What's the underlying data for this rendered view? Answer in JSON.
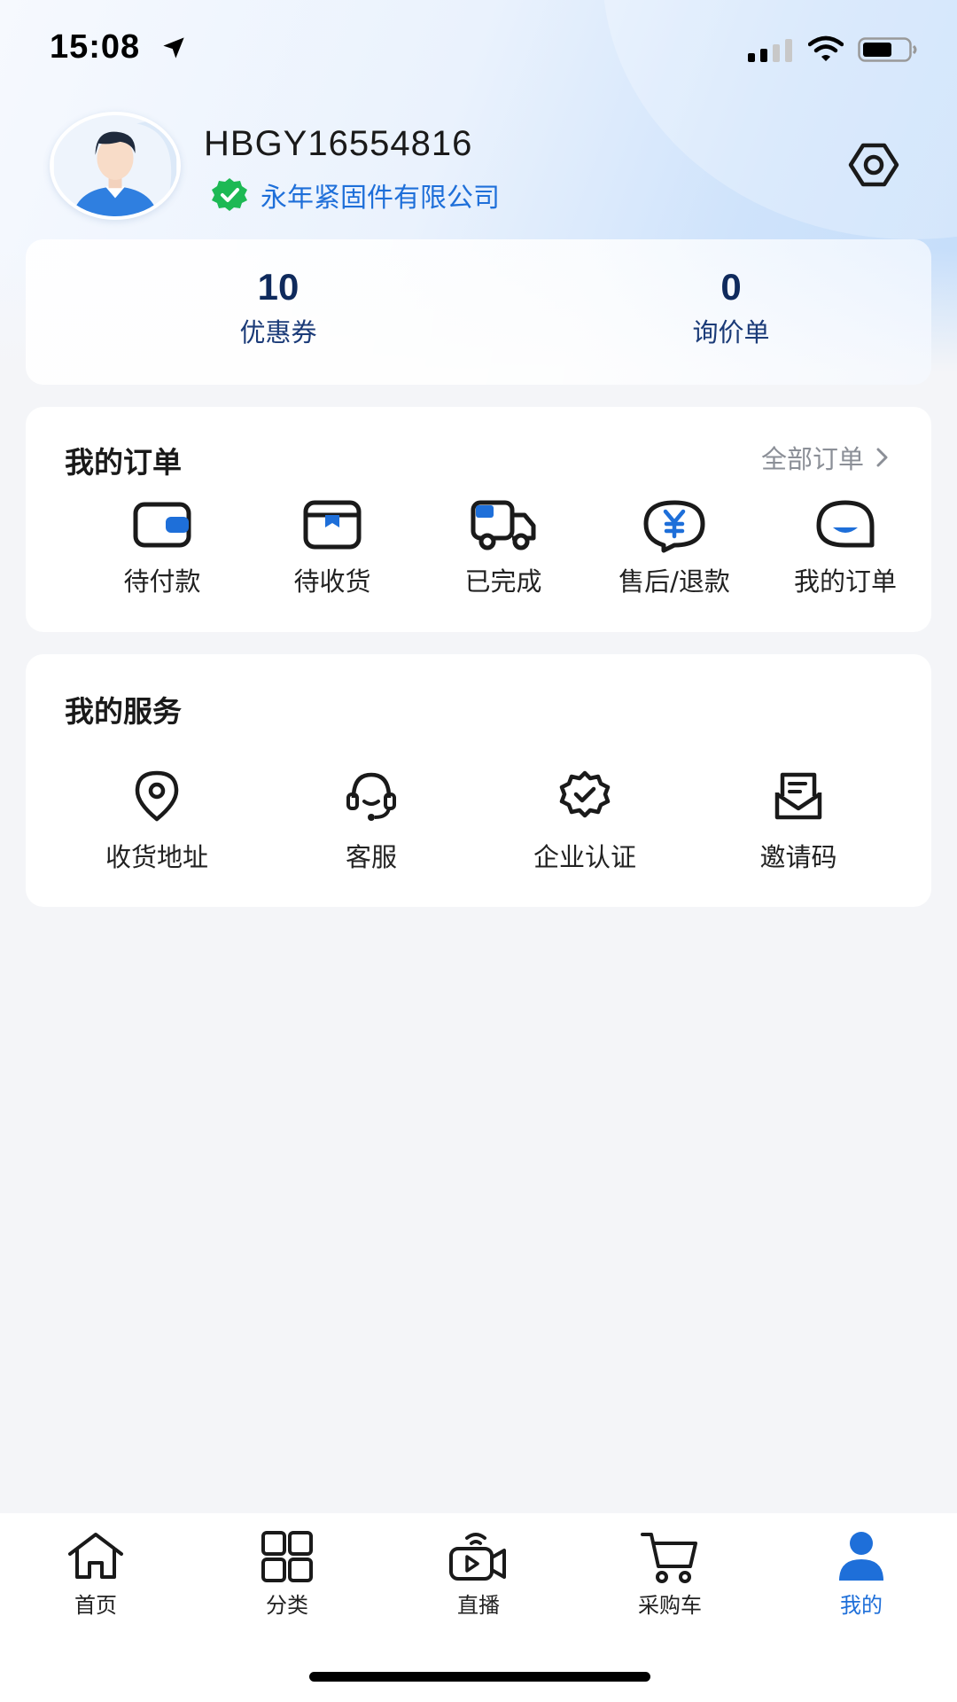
{
  "status_bar": {
    "time": "15:08"
  },
  "profile": {
    "username": "HBGY16554816",
    "company": "永年紧固件有限公司"
  },
  "stats": [
    {
      "value": "10",
      "label": "优惠券"
    },
    {
      "value": "0",
      "label": "询价单"
    }
  ],
  "orders": {
    "title": "我的订单",
    "all_link": "全部订单",
    "items": [
      {
        "label": "待付款",
        "icon": "wallet-icon"
      },
      {
        "label": "待收货",
        "icon": "package-icon"
      },
      {
        "label": "已完成",
        "icon": "truck-icon"
      },
      {
        "label": "售后/退款",
        "icon": "refund-icon"
      },
      {
        "label": "我的订单",
        "icon": "order-bubble-icon"
      }
    ]
  },
  "services": {
    "title": "我的服务",
    "items": [
      {
        "label": "收货地址",
        "icon": "location-pin-icon"
      },
      {
        "label": "客服",
        "icon": "headset-icon"
      },
      {
        "label": "企业认证",
        "icon": "verified-badge-icon"
      },
      {
        "label": "邀请码",
        "icon": "mail-icon"
      }
    ]
  },
  "nav": {
    "items": [
      {
        "label": "首页",
        "icon": "home-icon"
      },
      {
        "label": "分类",
        "icon": "grid-icon"
      },
      {
        "label": "直播",
        "icon": "live-camera-icon"
      },
      {
        "label": "采购车",
        "icon": "cart-icon"
      },
      {
        "label": "我的",
        "icon": "user-icon",
        "active": true
      }
    ]
  },
  "colors": {
    "accent": "#1e6fd9",
    "verified_green": "#1db954",
    "text_dark": "#1a1a1a",
    "stat_number": "#0f2a5c"
  }
}
